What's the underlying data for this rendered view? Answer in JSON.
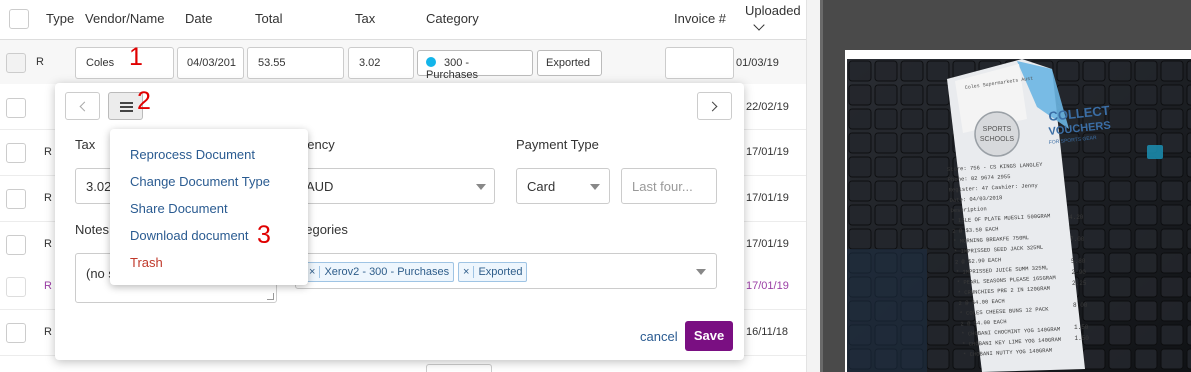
{
  "table": {
    "headers": {
      "type": "Type",
      "vendor": "Vendor/Name",
      "date": "Date",
      "total": "Total",
      "tax": "Tax",
      "category": "Category",
      "invoice": "Invoice #",
      "uploaded": "Uploaded"
    },
    "first_row": {
      "type": "R",
      "vendor": "Coles",
      "date": "04/03/201",
      "total": "53.55",
      "tax": "3.02",
      "category": "300 - Purchases",
      "status": "Exported",
      "invoice": "",
      "uploaded": "01/03/19"
    },
    "rows": [
      {
        "type": "",
        "uploaded": "22/02/19"
      },
      {
        "type": "R",
        "uploaded": "17/01/19"
      },
      {
        "type": "R",
        "uploaded": "17/01/19"
      },
      {
        "type": "R",
        "uploaded": "17/01/19"
      },
      {
        "type": "R",
        "uploaded": "17/01/19"
      },
      {
        "type": "R",
        "uploaded": "16/11/18"
      }
    ]
  },
  "panel": {
    "tax_label": "Tax",
    "tax_value": "3.02",
    "currency_label": "Currency",
    "currency_value": "AUD",
    "payment_label": "Payment Type",
    "payment_value": "Card",
    "last_four_placeholder": "Last four...",
    "notes_label": "Notes",
    "notes_value": "(no s",
    "categories_label": "Categories",
    "category_tags": [
      "Xerov2 - 300 - Purchases",
      "Exported"
    ],
    "tag_remove": "×",
    "cancel_label": "cancel",
    "save_label": "Save"
  },
  "menu": {
    "items": [
      "Reprocess Document",
      "Change Document Type",
      "Share Document",
      "Download document",
      "Trash"
    ]
  },
  "annotations": [
    "1",
    "2",
    "3"
  ],
  "receipt": {
    "store": "Coles Supermarkets Aust",
    "promo_line1": "COLLECT",
    "promo_line2": "VOUCHERS",
    "promo_line3": "FOR SPORTS GEAR",
    "lines": [
      "Store: 756 - CS KINGS LANGLEY",
      "Phone: 02 9674 2955",
      "Register: 47  Cashier: Jenny",
      "Date: 04/03/2018",
      "Description",
      "* ISLE OF PLATE MUESLI 500GRAM",
      "2 @ $3.50 EACH",
      "* MORNING BREAKFE 750ML",
      "* IMPRISSED SEED JACK 325ML",
      "2 @ $2.90 EACH",
      "* IMPRISSED JUICE SUMM 325ML",
      "* PEARL SEASONS PLEASE 165GRAM",
      "* CRUNCHIES PRE 2 IN 120GRAM",
      "2 @ $4.00 EACH",
      "* COLES CHEESE BUNS 12 PACK",
      "2 @ $4.00 EACH",
      "* CHOBANI CHOCMINT YOG 140GRAM",
      "* CHOBANI KEY LIME YOG 140GRAM",
      "* CHOBANI NUTTY YOG 140GRAM"
    ],
    "prices": [
      "4.20",
      "",
      "7.00",
      "",
      "5.80",
      "2.90",
      "2.25",
      "",
      "8.00",
      "",
      "1.50",
      "1.50"
    ]
  },
  "colors": {
    "accent": "#7a0f82",
    "link": "#2a5b91",
    "danger": "#c0392b",
    "annotation": "#e00000",
    "xero": "#13b5ea"
  }
}
